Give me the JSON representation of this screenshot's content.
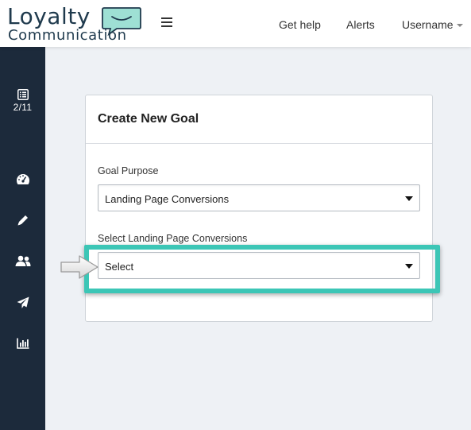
{
  "brand": {
    "line1": "Loyalty",
    "line2": "Communication",
    "color": "#1f3a4d",
    "accent": "#3cc6b6"
  },
  "header": {
    "menu_icon": "hamburger-icon",
    "links": {
      "help": "Get help",
      "alerts": "Alerts",
      "username": "Username"
    }
  },
  "sidebar": {
    "background": "#1c2a3b",
    "items": [
      {
        "icon": "list-icon",
        "count": "2/11"
      },
      {
        "icon": "dashboard-icon"
      },
      {
        "icon": "pencil-icon"
      },
      {
        "icon": "users-icon"
      },
      {
        "icon": "paper-plane-icon"
      },
      {
        "icon": "bar-chart-icon"
      }
    ]
  },
  "card": {
    "title": "Create New Goal",
    "goal_purpose": {
      "label": "Goal Purpose",
      "value": "Landing Page Conversions"
    },
    "landing_page": {
      "label": "Select Landing Page Conversions",
      "value": "Select"
    }
  },
  "annotation": {
    "highlight_color": "#3cc6b6",
    "pointer_icon": "arrow-pointer-icon"
  }
}
